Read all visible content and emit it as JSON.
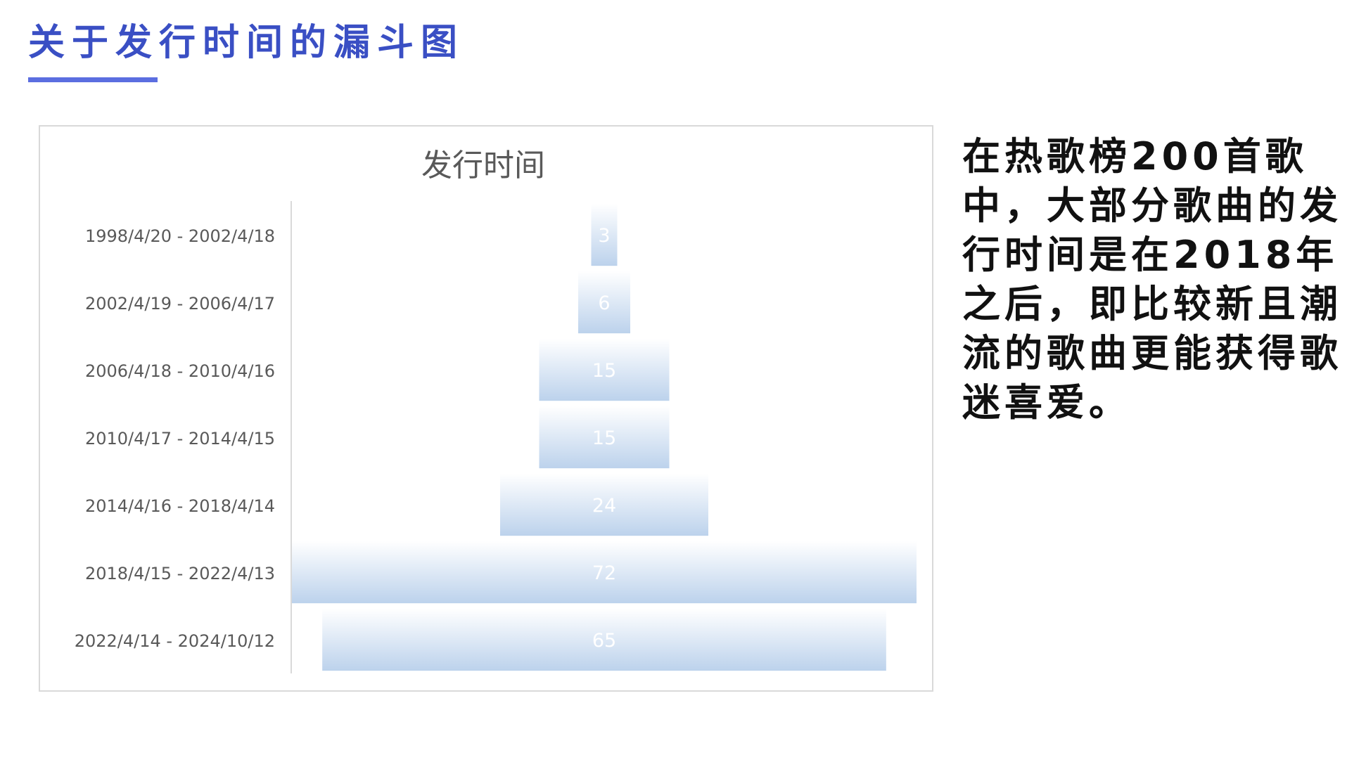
{
  "slide": {
    "title": "关于发行时间的漏斗图",
    "description": "在热歌榜200首歌中，大部分歌曲的发行时间是在2018年之后，即比较新且潮流的歌曲更能获得歌迷喜爱。"
  },
  "colors": {
    "title": "#3a4fc4",
    "underline": "#5b6ee0",
    "bar_top": "#ffffff",
    "bar_bottom": "#bcd2ec",
    "category_label": "#595959",
    "value_label": "#ffffff",
    "chart_title": "#595959",
    "axis": "#d9d9d9"
  },
  "chart_data": {
    "type": "bar",
    "subtype": "funnel",
    "title": "发行时间",
    "xlabel": "",
    "ylabel": "",
    "grid": false,
    "categories": [
      "1998/4/20 - 2002/4/18",
      "2002/4/19 - 2006/4/17",
      "2006/4/18 - 2010/4/16",
      "2010/4/17 - 2014/4/15",
      "2014/4/16 - 2018/4/14",
      "2018/4/15 - 2022/4/13",
      "2022/4/14 - 2024/10/12"
    ],
    "values": [
      3,
      6,
      15,
      15,
      24,
      72,
      65
    ],
    "value_labels": [
      "3",
      "6",
      "15",
      "15",
      "24",
      "72",
      "65"
    ]
  }
}
